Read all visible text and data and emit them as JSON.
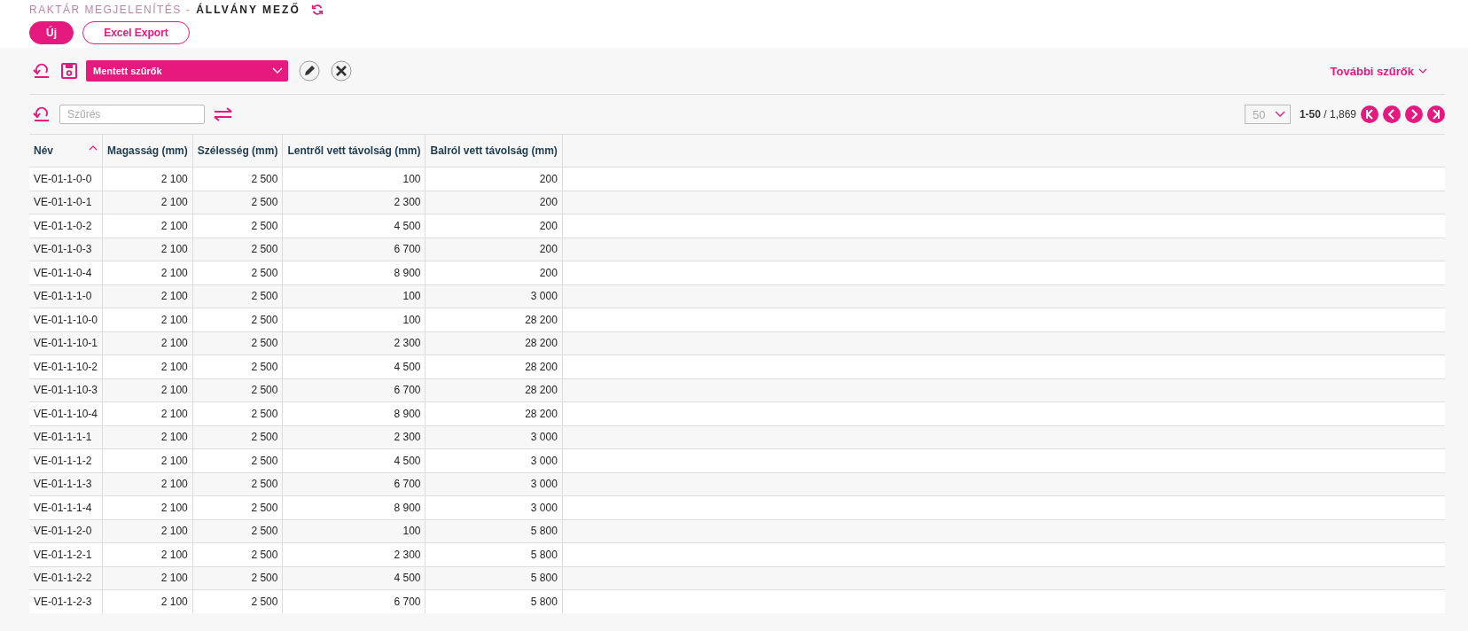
{
  "breadcrumb": {
    "parent": "RAKTÁR MEGJELENÍTÉS -",
    "current": "ÁLLVÁNY MEZŐ"
  },
  "actions": [
    {
      "label": "Új",
      "kind": "primary"
    },
    {
      "label": "Excel Export",
      "kind": "outline"
    }
  ],
  "saved_filters": {
    "value": "Mentett szűrők"
  },
  "more_filters": {
    "label": "További szűrők"
  },
  "filter": {
    "placeholder": "Szűrés"
  },
  "pagination": {
    "page_size": "50",
    "range": "1-50",
    "total": "/ 1,869"
  },
  "table": {
    "columns": [
      {
        "label": "Név",
        "sorted": true
      },
      {
        "label": "Magasság (mm)"
      },
      {
        "label": "Szélesség (mm)"
      },
      {
        "label": "Lentről vett távolság (mm)"
      },
      {
        "label": "Balról vett távolság (mm)"
      }
    ],
    "rows": [
      [
        "VE-01-1-0-0",
        "2 100",
        "2 500",
        "100",
        "200"
      ],
      [
        "VE-01-1-0-1",
        "2 100",
        "2 500",
        "2 300",
        "200"
      ],
      [
        "VE-01-1-0-2",
        "2 100",
        "2 500",
        "4 500",
        "200"
      ],
      [
        "VE-01-1-0-3",
        "2 100",
        "2 500",
        "6 700",
        "200"
      ],
      [
        "VE-01-1-0-4",
        "2 100",
        "2 500",
        "8 900",
        "200"
      ],
      [
        "VE-01-1-1-0",
        "2 100",
        "2 500",
        "100",
        "3 000"
      ],
      [
        "VE-01-1-10-0",
        "2 100",
        "2 500",
        "100",
        "28 200"
      ],
      [
        "VE-01-1-10-1",
        "2 100",
        "2 500",
        "2 300",
        "28 200"
      ],
      [
        "VE-01-1-10-2",
        "2 100",
        "2 500",
        "4 500",
        "28 200"
      ],
      [
        "VE-01-1-10-3",
        "2 100",
        "2 500",
        "6 700",
        "28 200"
      ],
      [
        "VE-01-1-10-4",
        "2 100",
        "2 500",
        "8 900",
        "28 200"
      ],
      [
        "VE-01-1-1-1",
        "2 100",
        "2 500",
        "2 300",
        "3 000"
      ],
      [
        "VE-01-1-1-2",
        "2 100",
        "2 500",
        "4 500",
        "3 000"
      ],
      [
        "VE-01-1-1-3",
        "2 100",
        "2 500",
        "6 700",
        "3 000"
      ],
      [
        "VE-01-1-1-4",
        "2 100",
        "2 500",
        "8 900",
        "3 000"
      ],
      [
        "VE-01-1-2-0",
        "2 100",
        "2 500",
        "100",
        "5 800"
      ],
      [
        "VE-01-1-2-1",
        "2 100",
        "2 500",
        "2 300",
        "5 800"
      ],
      [
        "VE-01-1-2-2",
        "2 100",
        "2 500",
        "4 500",
        "5 800"
      ],
      [
        "VE-01-1-2-3",
        "2 100",
        "2 500",
        "6 700",
        "5 800"
      ]
    ]
  }
}
